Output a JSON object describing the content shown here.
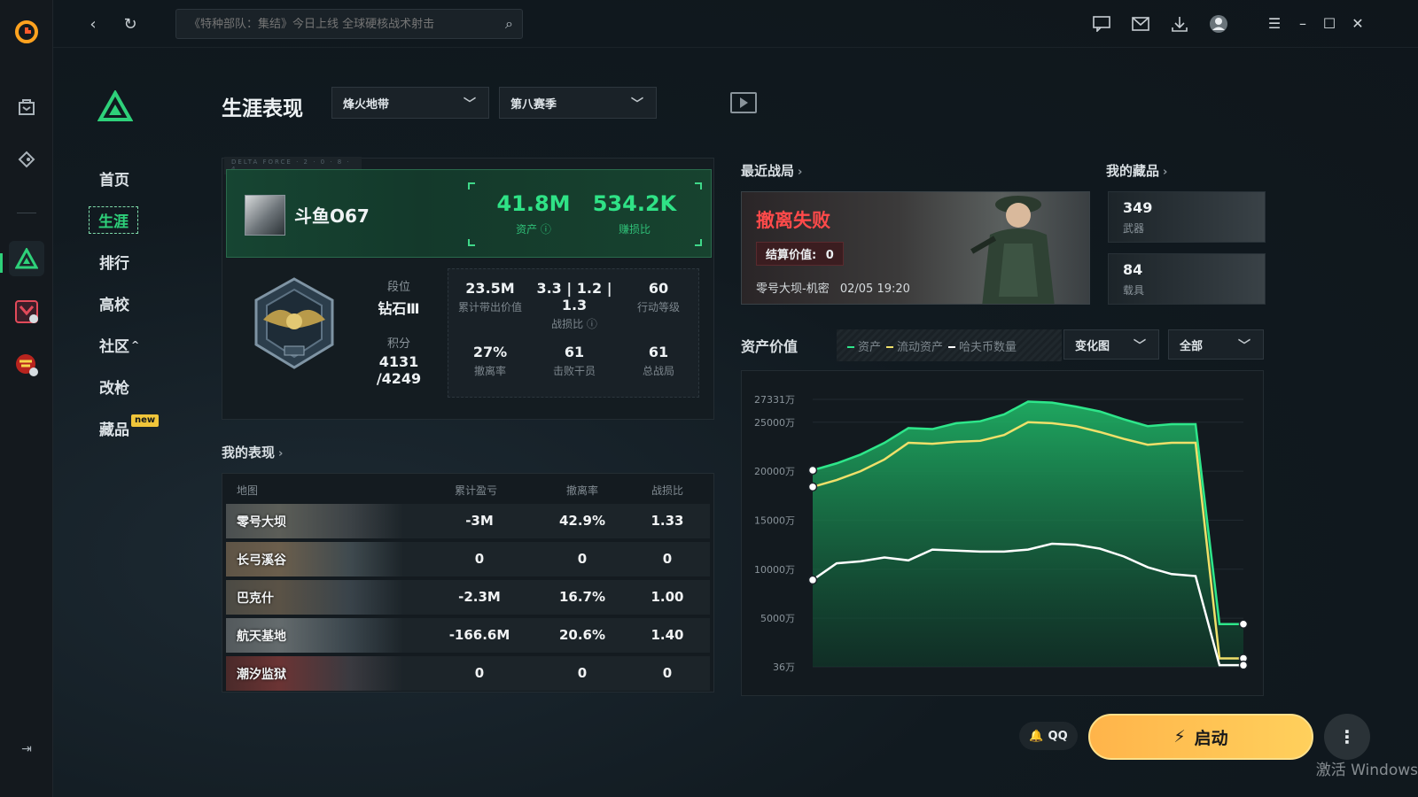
{
  "app": {
    "name": "WeGame"
  },
  "topbar": {
    "search_placeholder": "《特种部队：集结》今日上线 全球硬核战术射击"
  },
  "nav": {
    "items": [
      {
        "label": "首页"
      },
      {
        "label": "生涯"
      },
      {
        "label": "排行"
      },
      {
        "label": "高校"
      },
      {
        "label": "社区"
      },
      {
        "label": "改枪"
      },
      {
        "label": "藏品"
      }
    ],
    "new_badge": "new",
    "community_caret": "^"
  },
  "page": {
    "title": "生涯表现",
    "mode_select": "烽火地带",
    "season_select": "第八赛季"
  },
  "profile": {
    "banner_tag": "DELTA FORCE · 2 · 0 · 8 · 4",
    "username": "斗鱼O67",
    "assets_value": "41.8M",
    "assets_label": "资产",
    "profit_value": "534.2K",
    "profit_label": "赚损比",
    "rank_label": "段位",
    "rank_value": "钻石Ⅲ",
    "points_label": "积分",
    "points_value": "4131 /4249",
    "stats": [
      {
        "value": "23.5M",
        "label": "累计带出价值"
      },
      {
        "value": "3.3 | 1.2 | 1.3",
        "label": "战损比"
      },
      {
        "value": "60",
        "label": "行动等级"
      },
      {
        "value": "27%",
        "label": "撤离率"
      },
      {
        "value": "61",
        "label": "击败干员"
      },
      {
        "value": "61",
        "label": "总战局"
      }
    ]
  },
  "performance": {
    "title": "我的表现",
    "headers": [
      "地图",
      "累计盈亏",
      "撤离率",
      "战损比"
    ],
    "rows": [
      {
        "map": "零号大坝",
        "profit": "-3M",
        "rate": "42.9%",
        "kd": "1.33"
      },
      {
        "map": "长弓溪谷",
        "profit": "0",
        "rate": "0",
        "kd": "0"
      },
      {
        "map": "巴克什",
        "profit": "-2.3M",
        "rate": "16.7%",
        "kd": "1.00"
      },
      {
        "map": "航天基地",
        "profit": "-166.6M",
        "rate": "20.6%",
        "kd": "1.40"
      },
      {
        "map": "潮汐监狱",
        "profit": "0",
        "rate": "0",
        "kd": "0"
      }
    ]
  },
  "recent": {
    "title": "最近战局",
    "result": "撤离失败",
    "settle_label": "结算价值:",
    "settle_value": "0",
    "map": "零号大坝-机密",
    "time": "02/05 19:20"
  },
  "collection": {
    "title": "我的藏品",
    "items": [
      {
        "count": "349",
        "label": "武器"
      },
      {
        "count": "84",
        "label": "载具"
      }
    ]
  },
  "asset_chart": {
    "title": "资产价值",
    "legend": [
      "资产",
      "流动资产",
      "哈夫币数量"
    ],
    "view_select": "变化图",
    "range_select": "全部"
  },
  "chart_data": {
    "type": "area",
    "title": "资产价值",
    "ytick_labels": [
      "27331万",
      "25000万",
      "20000万",
      "15000万",
      "10000万",
      "5000万",
      "36万"
    ],
    "yticks": [
      27331,
      25000,
      20000,
      15000,
      10000,
      5000,
      36
    ],
    "ylim": [
      36,
      27331
    ],
    "series": [
      {
        "name": "资产",
        "color": "#2ee68a",
        "values": [
          20100,
          20800,
          21700,
          22900,
          24400,
          24300,
          24900,
          25100,
          25800,
          27100,
          27000,
          26600,
          26100,
          25300,
          24600,
          24800,
          24800,
          4400,
          4400
        ]
      },
      {
        "name": "流动资产",
        "color": "#f0e06a",
        "values": [
          18400,
          19100,
          20000,
          21200,
          22900,
          22800,
          23000,
          23100,
          23700,
          25000,
          24900,
          24600,
          24000,
          23300,
          22700,
          22900,
          22900,
          900,
          900
        ]
      },
      {
        "name": "哈夫币数量",
        "color": "#ffffff",
        "values": [
          8900,
          10600,
          10800,
          11200,
          10900,
          12000,
          11900,
          11800,
          11800,
          12000,
          12600,
          12500,
          12100,
          11300,
          10200,
          9500,
          9300,
          200,
          200
        ]
      }
    ]
  },
  "footer": {
    "qq": "QQ",
    "launch": "启动",
    "more": "⋮",
    "watermark": "激活 Windows"
  },
  "colors": {
    "accent": "#2ed17a",
    "fail": "#ff4a4a",
    "launch": "#ffc04f"
  }
}
